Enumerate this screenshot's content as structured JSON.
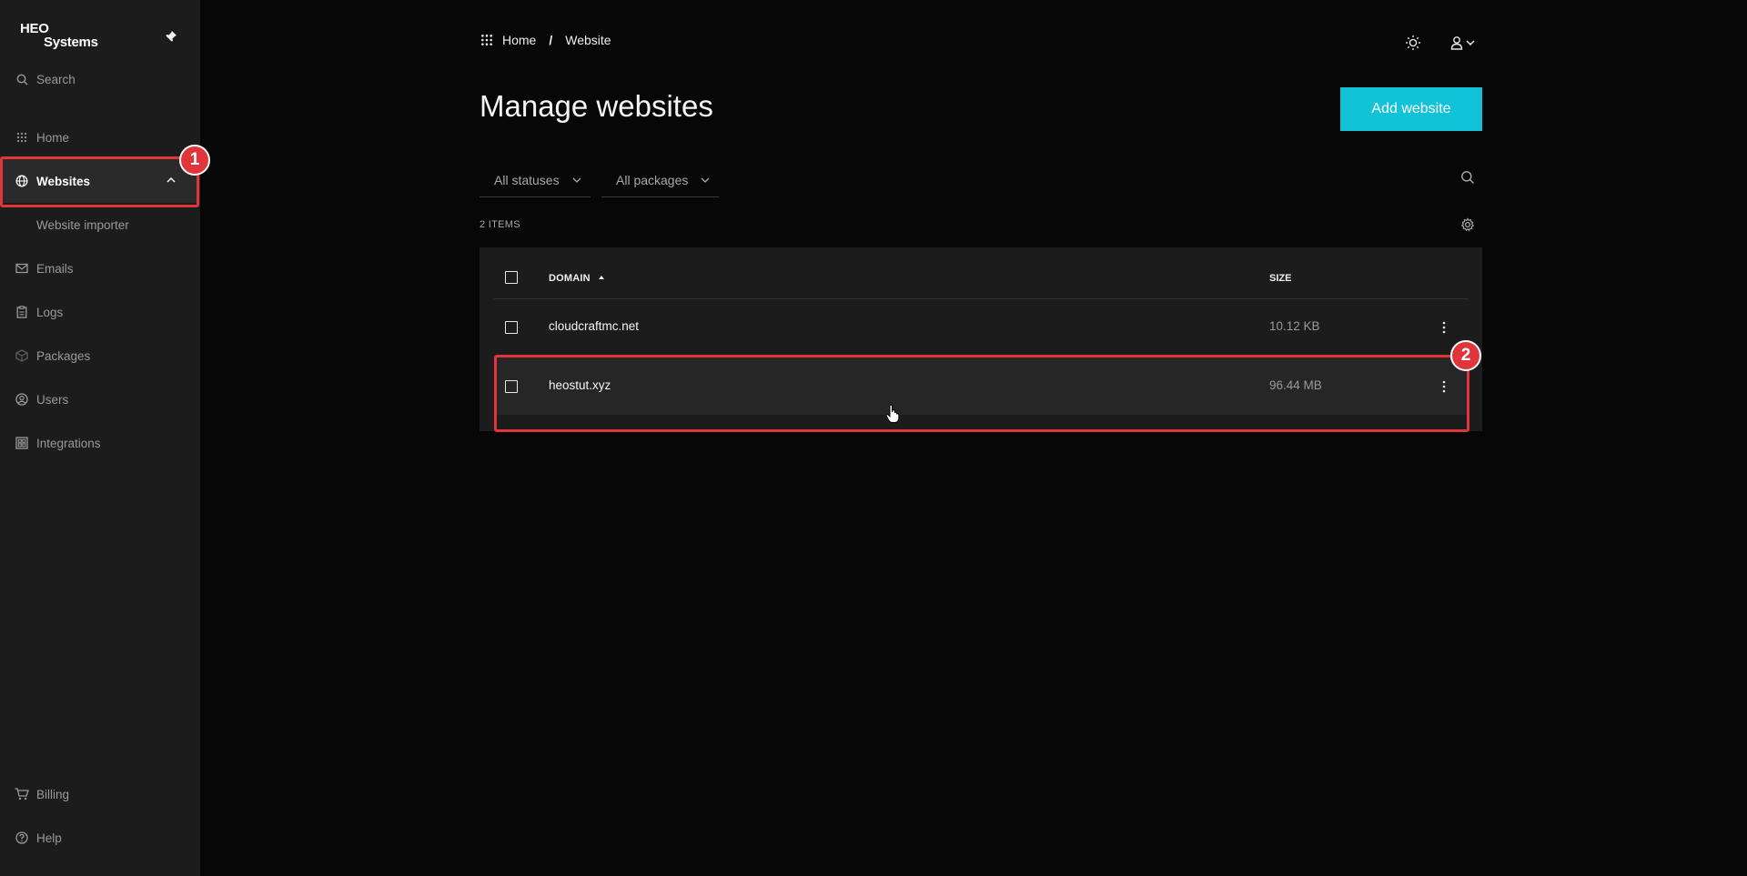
{
  "brand": {
    "line1": "HEO",
    "line2": "Systems"
  },
  "sidebar": {
    "search_label": "Search",
    "items": [
      {
        "label": "Home",
        "icon": "grid-icon"
      },
      {
        "label": "Websites",
        "icon": "globe-icon",
        "active": true
      },
      {
        "label": "Website importer",
        "sub": true
      },
      {
        "label": "Emails",
        "icon": "mail-icon"
      },
      {
        "label": "Logs",
        "icon": "clipboard-icon"
      },
      {
        "label": "Packages",
        "icon": "box-icon"
      },
      {
        "label": "Users",
        "icon": "user-circle-icon"
      },
      {
        "label": "Integrations",
        "icon": "integrations-icon"
      }
    ],
    "bottom_items": [
      {
        "label": "Billing",
        "icon": "cart-icon"
      },
      {
        "label": "Help",
        "icon": "help-icon"
      }
    ]
  },
  "breadcrumb": {
    "home": "Home",
    "separator": "/",
    "current": "Website"
  },
  "page": {
    "title": "Manage websites",
    "add_button": "Add website"
  },
  "filters": {
    "status": "All statuses",
    "packages": "All packages"
  },
  "list": {
    "items_count": "2 ITEMS",
    "columns": {
      "domain": "DOMAIN",
      "size": "SIZE"
    },
    "rows": [
      {
        "domain": "cloudcraftmc.net",
        "size": "10.12 KB"
      },
      {
        "domain": "heostut.xyz",
        "size": "96.44 MB"
      }
    ]
  },
  "annotations": {
    "badge1": "1",
    "badge2": "2"
  },
  "colors": {
    "accent": "#12c2d9",
    "annotation": "#e0353a",
    "background": "#070707",
    "sidebar": "#1c1c1c"
  }
}
